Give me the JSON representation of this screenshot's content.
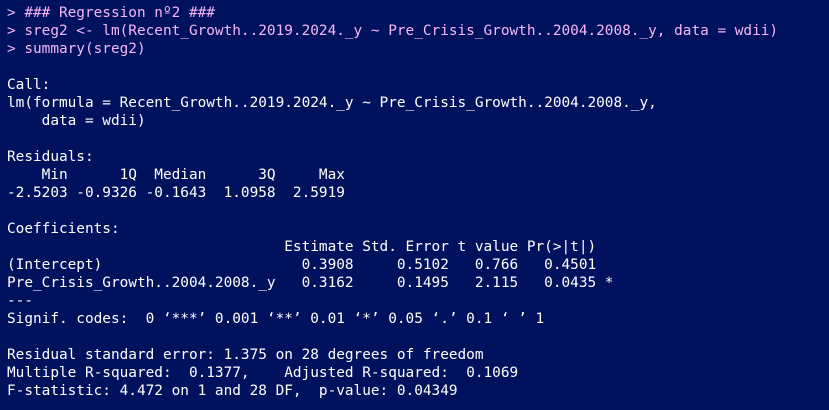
{
  "colors": {
    "background": "#00125e",
    "command_text": "#f6b7f6",
    "output_text": "#ffffff"
  },
  "console": {
    "commands": [
      "> ### Regression nº2 ###",
      "> sreg2 <- lm(Recent_Growth..2019.2024._y ~ Pre_Crisis_Growth..2004.2008._y, data = wdii)",
      "> summary(sreg2)"
    ],
    "call": {
      "header": "Call:",
      "line1": "lm(formula = Recent_Growth..2019.2024._y ~ Pre_Crisis_Growth..2004.2008._y,",
      "line2": "    data = wdii)"
    },
    "residuals": {
      "header": "Residuals:",
      "labels": "    Min      1Q  Median      3Q     Max ",
      "values": "-2.5203 -0.9326 -0.1643  1.0958  2.5919 "
    },
    "coefficients": {
      "header": "Coefficients:",
      "columns": "                                Estimate Std. Error t value Pr(>|t|)  ",
      "rows": [
        "(Intercept)                       0.3908     0.5102   0.766   0.4501  ",
        "Pre_Crisis_Growth..2004.2008._y   0.3162     0.1495   2.115   0.0435 *"
      ],
      "separator": "---",
      "signif": "Signif. codes:  0 ‘***’ 0.001 ‘**’ 0.01 ‘*’ 0.05 ‘.’ 0.1 ‘ ’ 1"
    },
    "fit": {
      "rse": "Residual standard error: 1.375 on 28 degrees of freedom",
      "r2": "Multiple R-squared:  0.1377,\tAdjusted R-squared:  0.1069 ",
      "f": "F-statistic: 4.472 on 1 and 28 DF,  p-value: 0.04349"
    }
  }
}
